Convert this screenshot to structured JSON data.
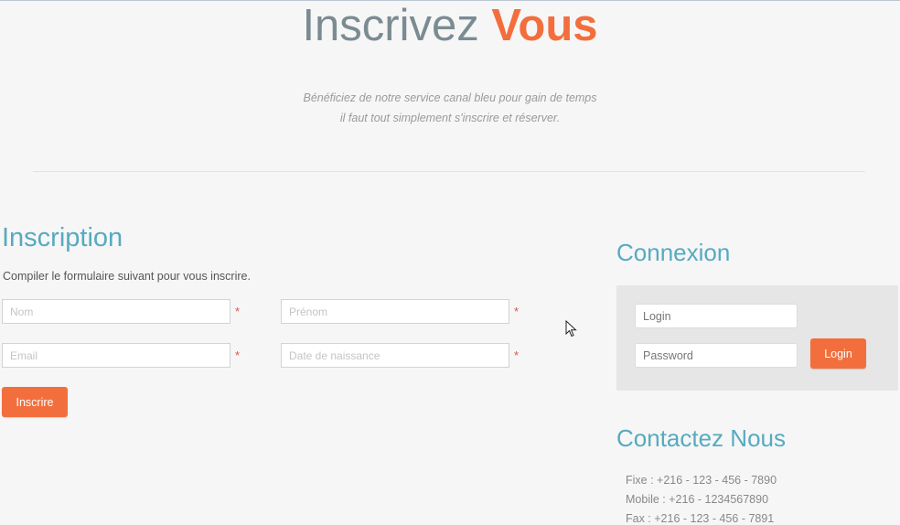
{
  "hero": {
    "title_plain": "Inscrivez",
    "title_accent": "Vous",
    "subtitle_line1": "Bénéficiez de notre service canal bleu pour gain de temps",
    "subtitle_line2": "il faut tout simplement s'inscrire et réserver."
  },
  "inscription": {
    "heading": "Inscription",
    "intro": "Compiler le formulaire suivant pour vous inscrire.",
    "fields": {
      "nom": {
        "placeholder": "Nom",
        "value": ""
      },
      "prenom": {
        "placeholder": "Prénom",
        "value": ""
      },
      "email": {
        "placeholder": "Email",
        "value": ""
      },
      "birthdate": {
        "placeholder": "Date de naissance",
        "value": ""
      }
    },
    "required_mark": "*",
    "submit_label": "Inscrire"
  },
  "connexion": {
    "heading": "Connexion",
    "login_placeholder": "Login",
    "password_placeholder": "Password",
    "button_label": "Login"
  },
  "contact": {
    "heading": "Contactez Nous",
    "lines": [
      "Fixe : +216 - 123 - 456 - 7890",
      "Mobile : +216 - 1234567890",
      "Fax : +216 - 123 - 456 - 7891"
    ]
  },
  "colors": {
    "accent": "#f26f3d",
    "heading": "#57aac0",
    "title_gray": "#7b8b92"
  },
  "icons": {
    "cursor": "mouse-pointer-icon"
  }
}
